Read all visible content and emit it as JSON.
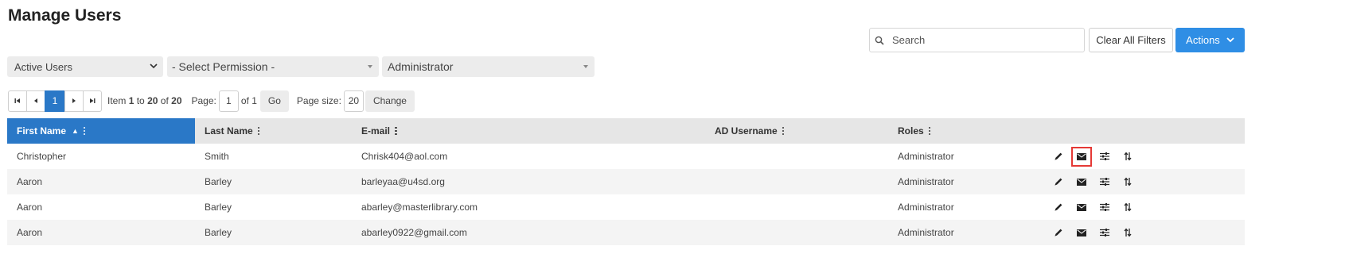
{
  "page": {
    "title": "Manage Users"
  },
  "toolbar": {
    "search_placeholder": "Search",
    "search_value": "",
    "clear_label": "Clear All Filters",
    "actions_label": "Actions"
  },
  "filters": {
    "status": "Active Users",
    "permission": "- Select Permission -",
    "role": "Administrator"
  },
  "pager": {
    "current_page": "1",
    "item_prefix": "Item",
    "item_from": "1",
    "item_to_word": "to",
    "item_to": "20",
    "item_of_word": "of",
    "item_total": "20",
    "page_label": "Page:",
    "page_value": "1",
    "of_pages": "of 1",
    "go_label": "Go",
    "size_label": "Page size:",
    "size_value": "20",
    "change_label": "Change"
  },
  "table": {
    "columns": {
      "first_name": "First Name",
      "last_name": "Last Name",
      "email": "E-mail",
      "ad_username": "AD Username",
      "roles": "Roles"
    },
    "sort_indicator": "▲",
    "rows": [
      {
        "first": "Christopher",
        "last": "Smith",
        "email": "Chrisk404@aol.com",
        "ad": "",
        "role": "Administrator"
      },
      {
        "first": "Aaron",
        "last": "Barley",
        "email": "barleyaa@u4sd.org",
        "ad": "",
        "role": "Administrator"
      },
      {
        "first": "Aaron",
        "last": "Barley",
        "email": "abarley@masterlibrary.com",
        "ad": "",
        "role": "Administrator"
      },
      {
        "first": "Aaron",
        "last": "Barley",
        "email": "abarley0922@gmail.com",
        "ad": "",
        "role": "Administrator"
      }
    ],
    "row_icons": [
      "pencil-icon",
      "envelope-icon",
      "sliders-icon",
      "sort-arrows-icon"
    ]
  },
  "colors": {
    "primary": "#2f8ee5",
    "sorted_header": "#2a78c7",
    "highlight": "#e53935"
  }
}
